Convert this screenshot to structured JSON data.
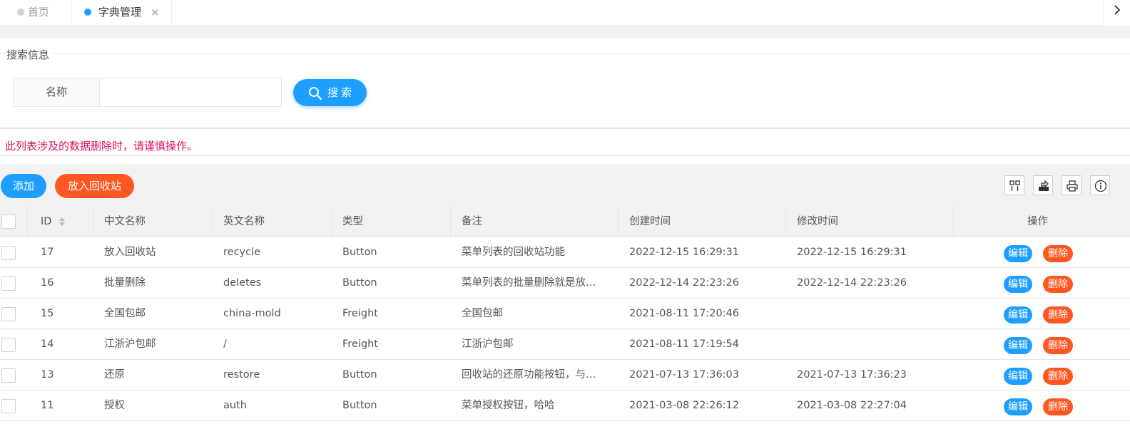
{
  "tabs": [
    {
      "label": "首页",
      "active": false
    },
    {
      "label": "字典管理",
      "active": true
    }
  ],
  "tab_close": "×",
  "tab_next": "›",
  "search": {
    "legend": "搜索信息",
    "field_label": "名称",
    "value": "",
    "button_label": "搜索"
  },
  "warning": "此列表涉及的数据删除时，请谨慎操作。",
  "toolbar": {
    "add_label": "添加",
    "recycle_label": "放入回收站",
    "icons": [
      "columns-icon",
      "export-icon",
      "print-icon",
      "info-icon"
    ]
  },
  "table": {
    "headers": {
      "id": "ID",
      "cn": "中文名称",
      "en": "英文名称",
      "type": "类型",
      "note": "备注",
      "ctime": "创建时间",
      "mtime": "修改时间",
      "op": "操作"
    },
    "edit_label": "编辑",
    "delete_label": "删除",
    "rows": [
      {
        "id": "17",
        "cn": "放入回收站",
        "en": "recycle",
        "type": "Button",
        "note": "菜单列表的回收站功能",
        "ctime": "2022-12-15 16:29:31",
        "mtime": "2022-12-15 16:29:31"
      },
      {
        "id": "16",
        "cn": "批量删除",
        "en": "deletes",
        "type": "Button",
        "note": "菜单列表的批量删除就是放…",
        "ctime": "2022-12-14 22:23:26",
        "mtime": "2022-12-14 22:23:26"
      },
      {
        "id": "15",
        "cn": "全国包邮",
        "en": "china-mold",
        "type": "Freight",
        "note": "全国包邮",
        "ctime": "2021-08-11 17:20:46",
        "mtime": ""
      },
      {
        "id": "14",
        "cn": "江浙沪包邮",
        "en": "/",
        "type": "Freight",
        "note": "江浙沪包邮",
        "ctime": "2021-08-11 17:19:54",
        "mtime": ""
      },
      {
        "id": "13",
        "cn": "还原",
        "en": "restore",
        "type": "Button",
        "note": "回收站的还原功能按钮，与…",
        "ctime": "2021-07-13 17:36:03",
        "mtime": "2021-07-13 17:36:23"
      },
      {
        "id": "11",
        "cn": "授权",
        "en": "auth",
        "type": "Button",
        "note": "菜单授权按钮，哈哈",
        "ctime": "2021-03-08 22:26:12",
        "mtime": "2021-03-08 22:27:04"
      }
    ]
  },
  "colors": {
    "primary": "#1e9fff",
    "danger": "#ff5722",
    "warning_text": "#e0115f"
  }
}
